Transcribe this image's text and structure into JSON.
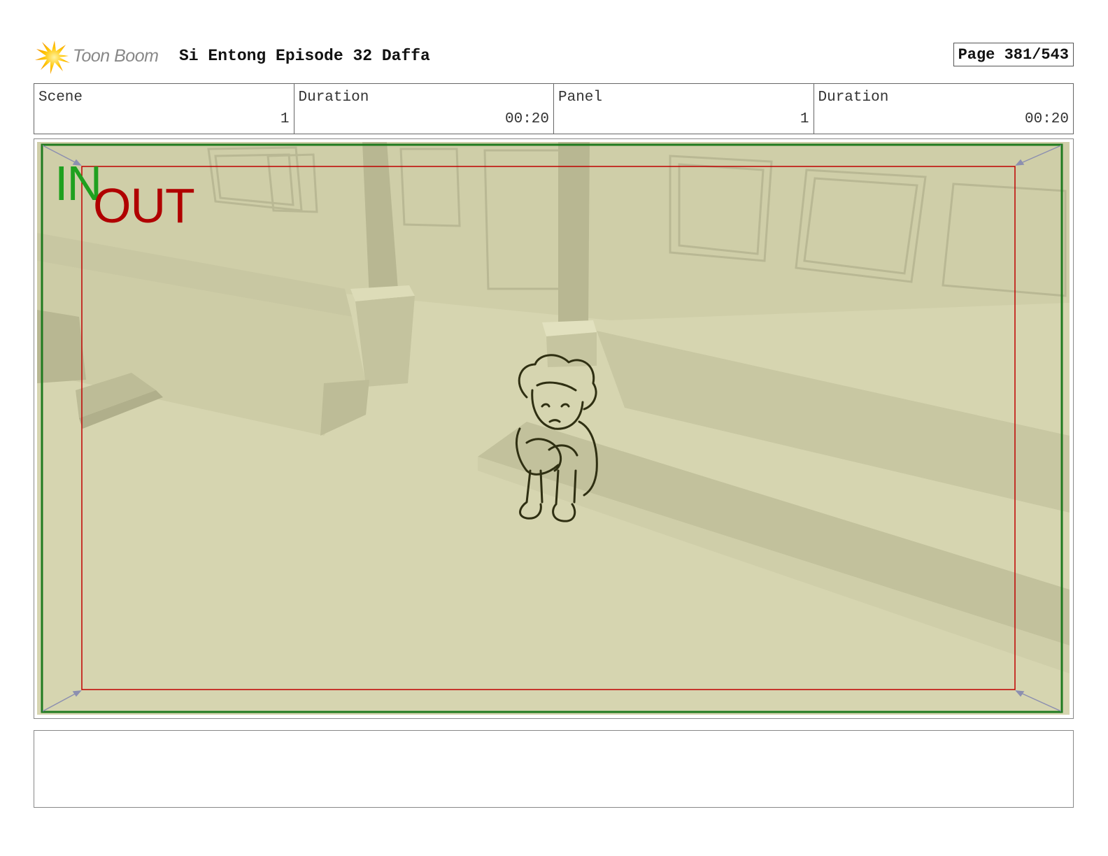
{
  "header": {
    "logo_text": "Toon Boom",
    "logo_icon": "starburst-logo-icon",
    "title": "Si Entong Episode 32 Daffa",
    "page_label": "Page 381/543"
  },
  "info": [
    {
      "label": "Scene",
      "value": "1"
    },
    {
      "label": "Duration",
      "value": "00:20"
    },
    {
      "label": "Panel",
      "value": "1"
    },
    {
      "label": "Duration",
      "value": "00:20"
    }
  ],
  "panel": {
    "in_label": "IN",
    "out_label": "OUT",
    "colors": {
      "background": "#d6d5b0",
      "in_frame": "#1f7a1f",
      "out_frame": "#c00000",
      "in_text": "#1fa01f",
      "out_text": "#b00000"
    }
  },
  "notes": {
    "text": ""
  }
}
